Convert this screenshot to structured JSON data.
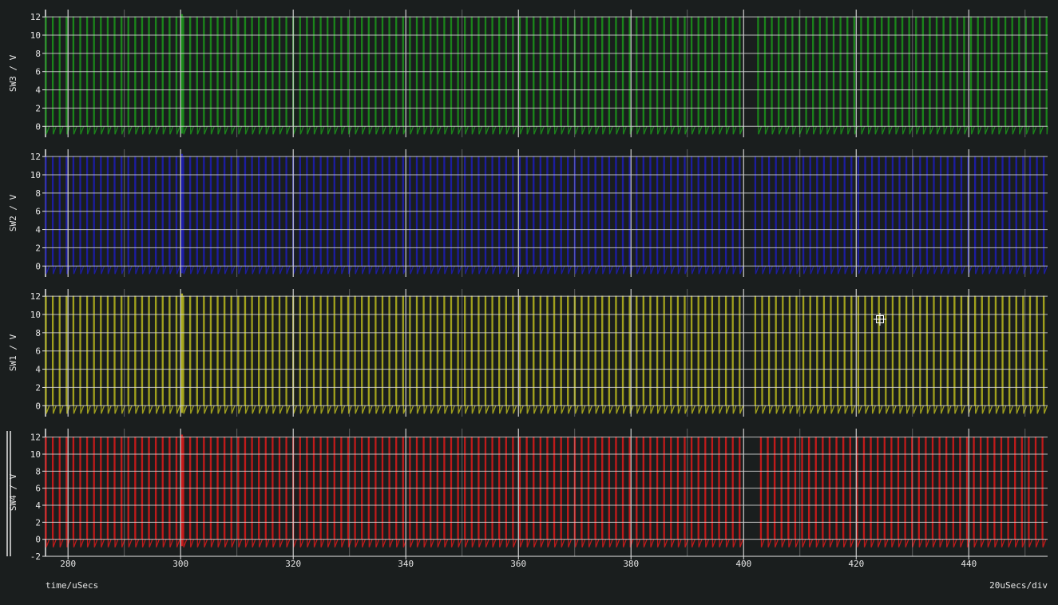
{
  "footer": {
    "xlabel": "time/uSecs",
    "timebase": "20uSecs/div"
  },
  "colors": {
    "background": "#1a1e1e",
    "grid": "#d8d8d8",
    "green": "#1a8a1a",
    "blue": "#1c1ca8",
    "yellow": "#a8a81c",
    "red": "#c81a1a"
  },
  "chart_data": [
    {
      "type": "line",
      "ylabel": "SW3 / V",
      "color": "#1a8a1a",
      "yticks": [
        0,
        2,
        4,
        6,
        8,
        10,
        12
      ],
      "ylim": [
        -1.2,
        12.8
      ],
      "xlim": [
        276,
        454
      ],
      "series": [
        {
          "low": 0,
          "high": 12,
          "period_us": 1.22,
          "start_us": 276,
          "gap_us": [
            400,
            402.5
          ],
          "end_us": 454
        }
      ]
    },
    {
      "type": "line",
      "ylabel": "SW2 / V",
      "color": "#1c1ca8",
      "yticks": [
        0,
        2,
        4,
        6,
        8,
        10,
        12
      ],
      "ylim": [
        -1.2,
        12.8
      ],
      "xlim": [
        276,
        454
      ],
      "series": [
        {
          "low": 0,
          "high": 12,
          "period_us": 1.22,
          "start_us": 276,
          "gap_us": [
            400,
            402
          ],
          "end_us": 454
        }
      ]
    },
    {
      "type": "line",
      "ylabel": "SW1 / V",
      "color": "#a8a81c",
      "yticks": [
        0,
        2,
        4,
        6,
        8,
        10,
        12
      ],
      "ylim": [
        -1.2,
        12.8
      ],
      "xlim": [
        276,
        454
      ],
      "series": [
        {
          "low": 0,
          "high": 12,
          "period_us": 1.22,
          "start_us": 276,
          "gap_us": [
            400,
            402
          ],
          "end_us": 454
        }
      ]
    },
    {
      "type": "line",
      "ylabel": "SW4 / V",
      "color": "#c81a1a",
      "yticks": [
        -2,
        0,
        2,
        4,
        6,
        8,
        10,
        12
      ],
      "ylim": [
        -2,
        13
      ],
      "xlim": [
        276,
        454
      ],
      "xticks": [
        280,
        300,
        320,
        340,
        360,
        380,
        400,
        420,
        440
      ],
      "series": [
        {
          "low": 0,
          "high": 12,
          "period_us": 1.22,
          "start_us": 276,
          "gap_us": [
            400,
            403
          ],
          "end_us": 454
        }
      ]
    }
  ]
}
